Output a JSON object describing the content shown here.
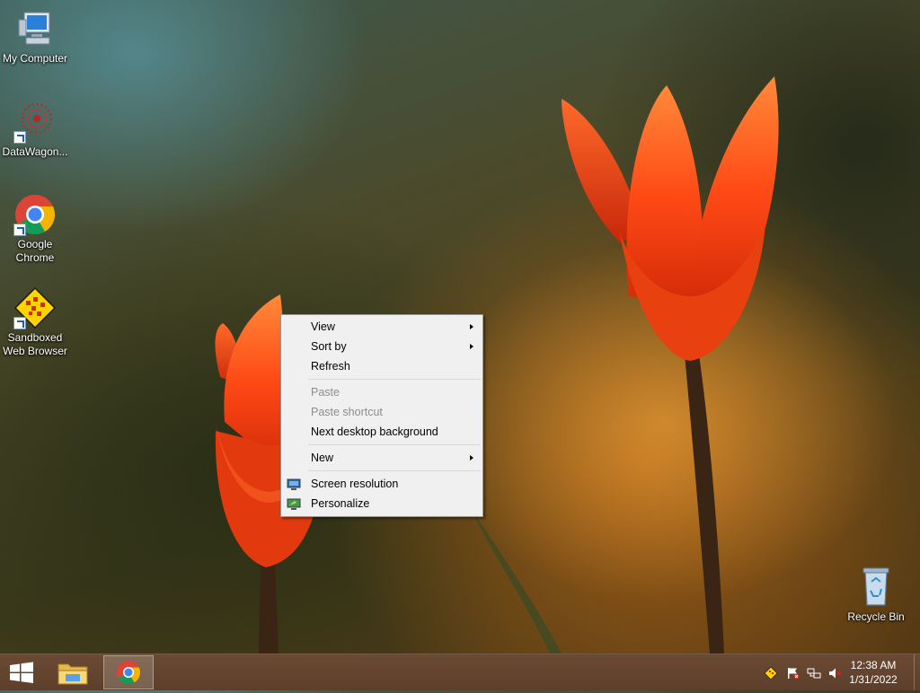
{
  "desktop": {
    "icons": [
      {
        "label": "My Computer"
      },
      {
        "label": "DataWagon..."
      },
      {
        "label": "Google Chrome"
      },
      {
        "label": "Sandboxed Web Browser"
      },
      {
        "label": "Recycle Bin"
      }
    ]
  },
  "context_menu": {
    "items": [
      {
        "label": "View",
        "has_submenu": true,
        "enabled": true
      },
      {
        "label": "Sort by",
        "has_submenu": true,
        "enabled": true
      },
      {
        "label": "Refresh",
        "enabled": true
      },
      {
        "label": "Paste",
        "enabled": false
      },
      {
        "label": "Paste shortcut",
        "enabled": false
      },
      {
        "label": "Next desktop background",
        "enabled": true
      },
      {
        "label": "New",
        "has_submenu": true,
        "enabled": true
      },
      {
        "label": "Screen resolution",
        "enabled": true,
        "icon": "screen-resolution-icon"
      },
      {
        "label": "Personalize",
        "enabled": true,
        "icon": "personalize-icon"
      }
    ]
  },
  "taskbar": {
    "pinned": [
      "windows-start-icon",
      "file-explorer-icon",
      "chrome-icon"
    ],
    "tray_icons": [
      "sandboxie-tray-icon",
      "action-center-flag-icon",
      "network-icon",
      "volume-muted-icon"
    ],
    "clock": {
      "time": "12:38 AM",
      "date": "1/31/2022"
    }
  },
  "colors": {
    "taskbar": "#5c3f2b",
    "menu_bg": "#f0f0f0",
    "tulip": "#ff4a1a"
  }
}
